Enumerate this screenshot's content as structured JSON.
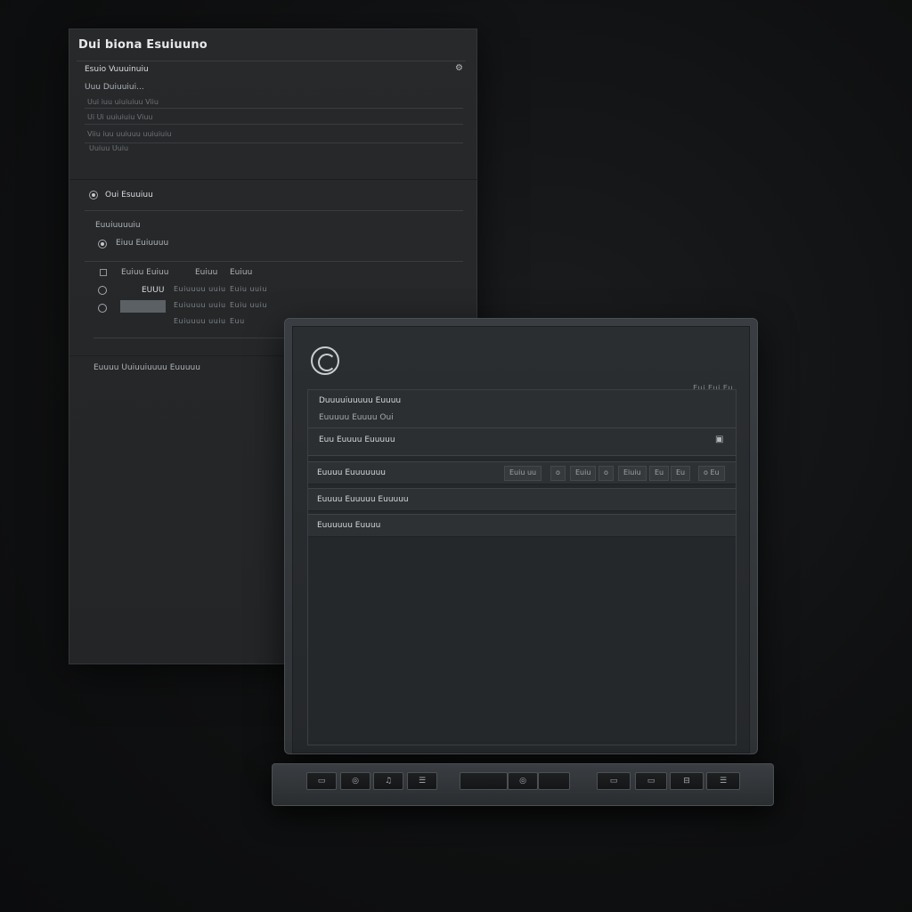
{
  "back_panel": {
    "title": "Dui biona Esuiuuno",
    "section1": {
      "line1": "Esuio Vuuuinuiu",
      "line2": "Uuu Duiuuiui...",
      "line3": "Uui iuu uiuiuiuu Viiu",
      "line4": "Ui Ui uuiuiuiu Viuu",
      "line5": "Viiu iuu uuiuuu uuiuiuiu",
      "line6": "Uuiuu Uuiu"
    },
    "section2": {
      "header": "Oui Esuuiuu",
      "label": "Euuiuuuuiu",
      "option": "Eiuu Euiuuuu",
      "table_headers": [
        "Euiuu Euiuu",
        "Euiuu",
        "Euiuu"
      ],
      "row1": [
        "EUUU",
        "Euiuuuu uuiu",
        "Euiu uuiu"
      ],
      "row2": [
        "",
        "Euiuuuu uuiu",
        "Euiu uuiu"
      ],
      "row3": [
        "",
        "Euiuuuu uuiu",
        "Euu"
      ]
    },
    "footer": "Euuuu Uuiuuiuuuu Euuuuu"
  },
  "device": {
    "status": "Eui Eui Eu",
    "window": {
      "title": "Duuuuiuuuuu Euuuu",
      "subtitle": "Euuuuu Euuuu Oui",
      "field": "Euu Euuuu Euuuuu",
      "toolbar_label": "Euuuu Euuuuuuu",
      "toolbar_buttons": [
        "Euiu uu",
        "o",
        "Euiu",
        "o",
        "Eiuiu",
        "Eu",
        "Eu",
        "o Eu"
      ],
      "row3": "Euuuu Euuuuu Euuuuu",
      "row4": "Euuuuuu Euuuu"
    }
  },
  "keys": [
    "▭",
    "◎",
    "♫",
    "☰",
    "",
    "◎",
    "",
    "▭",
    "▭",
    "⊟",
    "☰"
  ]
}
